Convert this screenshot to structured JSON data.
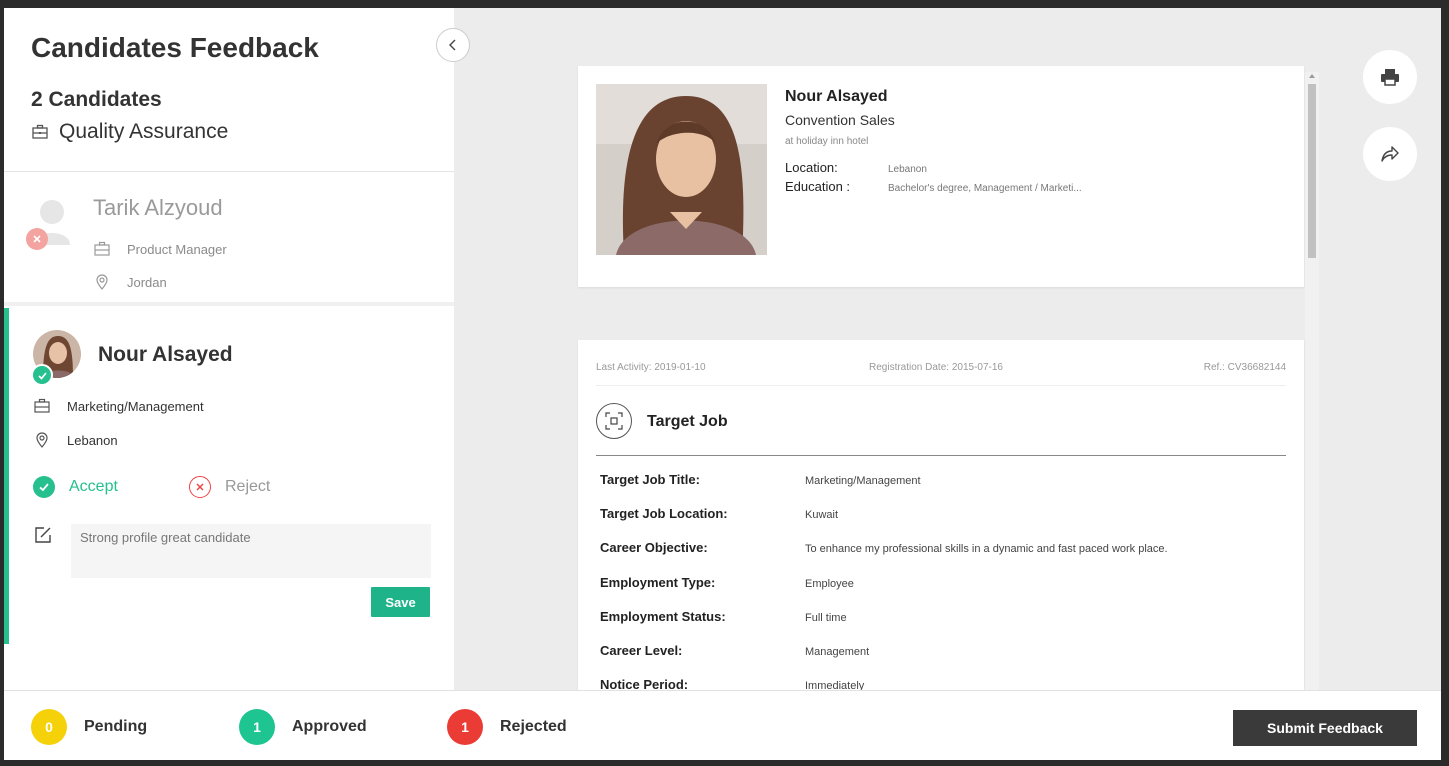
{
  "header": {
    "title": "Candidates Feedback",
    "count": "2 Candidates",
    "job": "Quality Assurance"
  },
  "candidates": [
    {
      "name": "Tarik Alzyoud",
      "title": "Product Manager",
      "location": "Jordan",
      "status": "rejected"
    },
    {
      "name": "Nour Alsayed",
      "title": "Marketing/Management",
      "location": "Lebanon",
      "status": "accepted",
      "accept_label": "Accept",
      "reject_label": "Reject",
      "comment": "Strong profile great candidate",
      "save_label": "Save"
    }
  ],
  "profile": {
    "name": "Nour Alsayed",
    "title": "Convention Sales",
    "company": "at holiday inn hotel",
    "location_label": "Location:",
    "location": "Lebanon",
    "education_label": "Education :",
    "education": "Bachelor's degree, Management / Marketi..."
  },
  "meta": {
    "last_activity": "Last Activity: 2019-01-10",
    "registration": "Registration Date: 2015-07-16",
    "ref": "Ref.: CV36682144"
  },
  "target_job": {
    "heading": "Target Job",
    "fields": [
      {
        "label": "Target Job Title:",
        "value": "Marketing/Management"
      },
      {
        "label": "Target Job Location:",
        "value": "Kuwait"
      },
      {
        "label": "Career Objective:",
        "value": "To enhance my professional skills in a dynamic and fast paced work place."
      },
      {
        "label": "Employment Type:",
        "value": "Employee"
      },
      {
        "label": "Employment Status:",
        "value": "Full time"
      },
      {
        "label": "Career Level:",
        "value": "Management"
      },
      {
        "label": "Notice Period:",
        "value": "Immediately"
      }
    ]
  },
  "footer": {
    "pending_count": "0",
    "pending_label": "Pending",
    "approved_count": "1",
    "approved_label": "Approved",
    "rejected_count": "1",
    "rejected_label": "Rejected",
    "submit_label": "Submit Feedback"
  },
  "colors": {
    "accent": "#25c08e",
    "pending": "#f5d10a",
    "approved": "#1fc591",
    "rejected": "#ea3b35",
    "submit": "#3a3a3a"
  },
  "icons": {
    "collapse": "chevron-left-icon",
    "print": "printer-icon",
    "share": "share-icon"
  }
}
